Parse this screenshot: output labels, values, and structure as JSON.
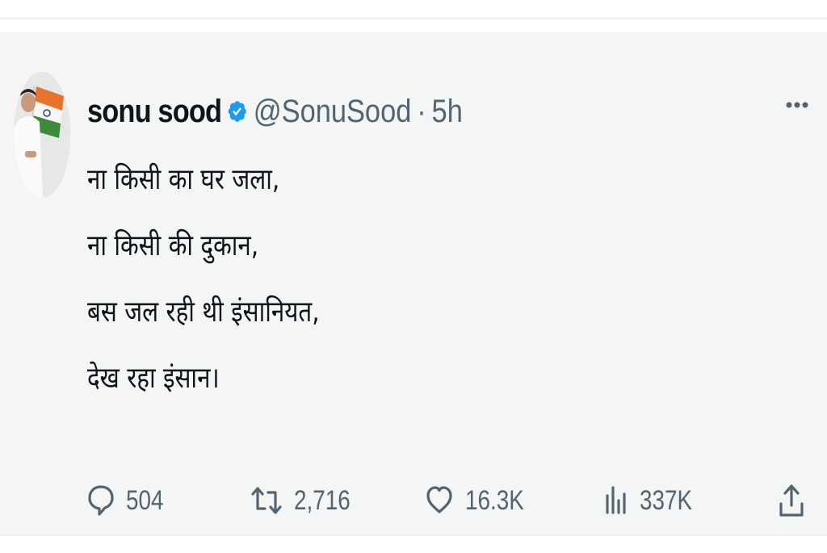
{
  "tweet": {
    "author": {
      "display_name": "sonu sood",
      "handle": "@SonuSood",
      "verified": true,
      "avatar_icon": "profile-photo-with-flag"
    },
    "separator": "·",
    "time": "5h",
    "text_lines": [
      "ना किसी का घर जला,",
      "ना किसी की दुकान,",
      "बस जल रही थी इंसानियत,",
      "देख रहा इंसान।"
    ],
    "stats": {
      "replies": "504",
      "reposts": "2,716",
      "likes": "16.3K",
      "views": "337K"
    }
  },
  "icons": {
    "more": "more-horizontal-icon",
    "reply": "reply-bubble-icon",
    "repost": "repost-icon",
    "like": "heart-icon",
    "views": "views-bar-chart-icon",
    "share": "share-upload-icon"
  },
  "colors": {
    "verified_blue": "#1d9bf0",
    "text_primary": "#0f1419",
    "text_secondary": "#536471",
    "card_background": "#f4f5f5"
  }
}
